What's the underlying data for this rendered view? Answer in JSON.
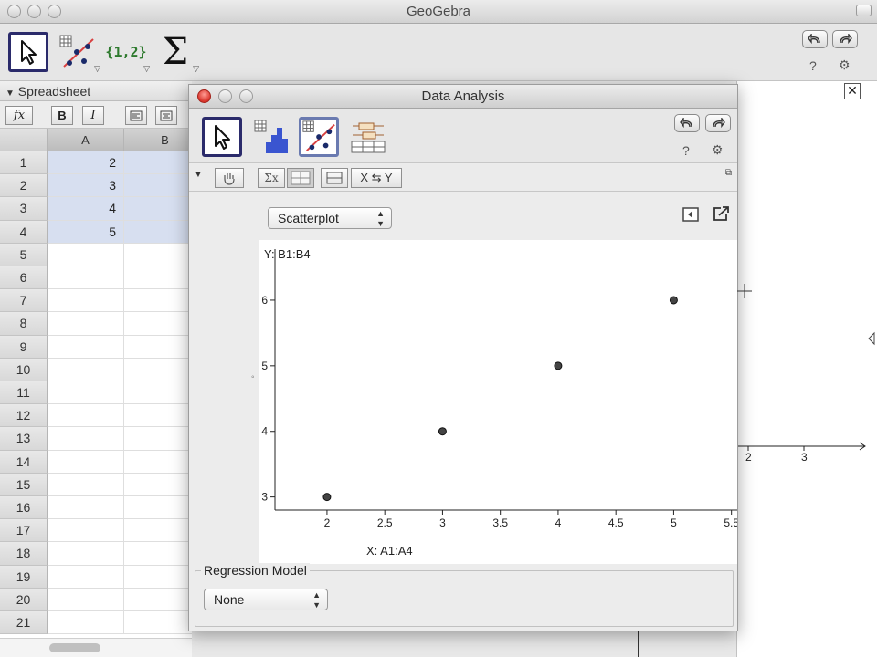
{
  "app": {
    "title": "GeoGebra"
  },
  "main_toolbar": {
    "set_tool_label": "{1,2}",
    "sum_tool_label": "Σ",
    "help_label": "?",
    "settings_label": "⚙"
  },
  "spreadsheet": {
    "title": "Spreadsheet",
    "format": {
      "fx": "fx",
      "bold": "B",
      "italic": "I"
    },
    "columns": [
      "A",
      "B"
    ],
    "rows": [
      "1",
      "2",
      "3",
      "4",
      "5",
      "6",
      "7",
      "8",
      "9",
      "10",
      "11",
      "12",
      "13",
      "14",
      "15",
      "16",
      "17",
      "18",
      "19",
      "20",
      "21"
    ],
    "cells_A": [
      "2",
      "3",
      "4",
      "5"
    ]
  },
  "dialog": {
    "title": "Data Analysis",
    "help_label": "?",
    "settings_label": "⚙",
    "swap_label": "X ⇆ Y",
    "sum_label": "Σx",
    "plot_type": "Scatterplot",
    "regression_legend": "Regression Model",
    "regression_value": "None"
  },
  "chart_data": {
    "type": "scatter",
    "title": "",
    "xlabel": "X:   A1:A4",
    "ylabel": "Y:   B1:B4",
    "x": [
      2,
      3,
      4,
      5
    ],
    "y": [
      3,
      4,
      5,
      6
    ],
    "xlim": [
      1.55,
      5.55
    ],
    "ylim": [
      2.8,
      6.5
    ],
    "x_ticks": [
      "2",
      "2.5",
      "3",
      "3.5",
      "4",
      "4.5",
      "5",
      "5.5"
    ],
    "x_tick_values": [
      2,
      2.5,
      3,
      3.5,
      4,
      4.5,
      5,
      5.5
    ],
    "y_ticks": [
      "3",
      "4",
      "5",
      "6"
    ],
    "y_tick_values": [
      3,
      4,
      5,
      6
    ],
    "grid": false,
    "point_color": "#444444"
  },
  "graphics_axis": {
    "tick_labels": [
      "2",
      "3"
    ]
  }
}
